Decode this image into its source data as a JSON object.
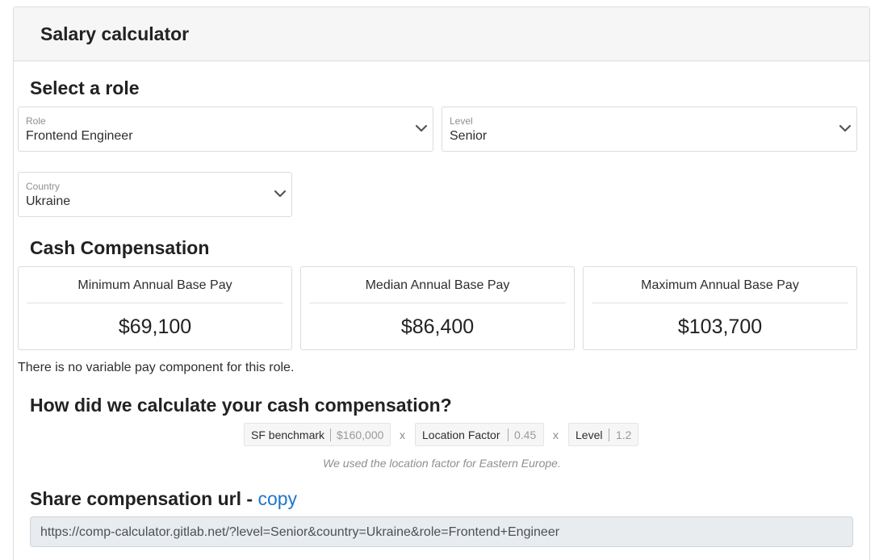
{
  "header": {
    "title": "Salary calculator"
  },
  "role_section": {
    "heading": "Select a role",
    "role": {
      "label": "Role",
      "value": "Frontend Engineer"
    },
    "level": {
      "label": "Level",
      "value": "Senior"
    },
    "country": {
      "label": "Country",
      "value": "Ukraine"
    }
  },
  "cash": {
    "heading": "Cash Compensation",
    "cards": [
      {
        "label": "Minimum Annual Base Pay",
        "value": "$69,100"
      },
      {
        "label": "Median Annual Base Pay",
        "value": "$86,400"
      },
      {
        "label": "Maximum Annual Base Pay",
        "value": "$103,700"
      }
    ],
    "note": "There is no variable pay component for this role."
  },
  "calculation": {
    "heading": "How did we calculate your cash compensation?",
    "factors": [
      {
        "name": "SF benchmark",
        "value": "$160,000"
      },
      {
        "name": "Location Factor",
        "value": "0.45"
      },
      {
        "name": "Level",
        "value": "1.2"
      }
    ],
    "operator": "x",
    "caption": "We used the location factor for Eastern Europe."
  },
  "share": {
    "heading": "Share compensation url - ",
    "copy_label": "copy",
    "url": "https://comp-calculator.gitlab.net/?level=Senior&country=Ukraine&role=Frontend+Engineer"
  },
  "colors": {
    "link": "#1f75cb",
    "header_bg": "#f6f6f6",
    "border": "#dcdcdc"
  },
  "icons": {
    "select_chevron": "chevron-down-icon"
  }
}
